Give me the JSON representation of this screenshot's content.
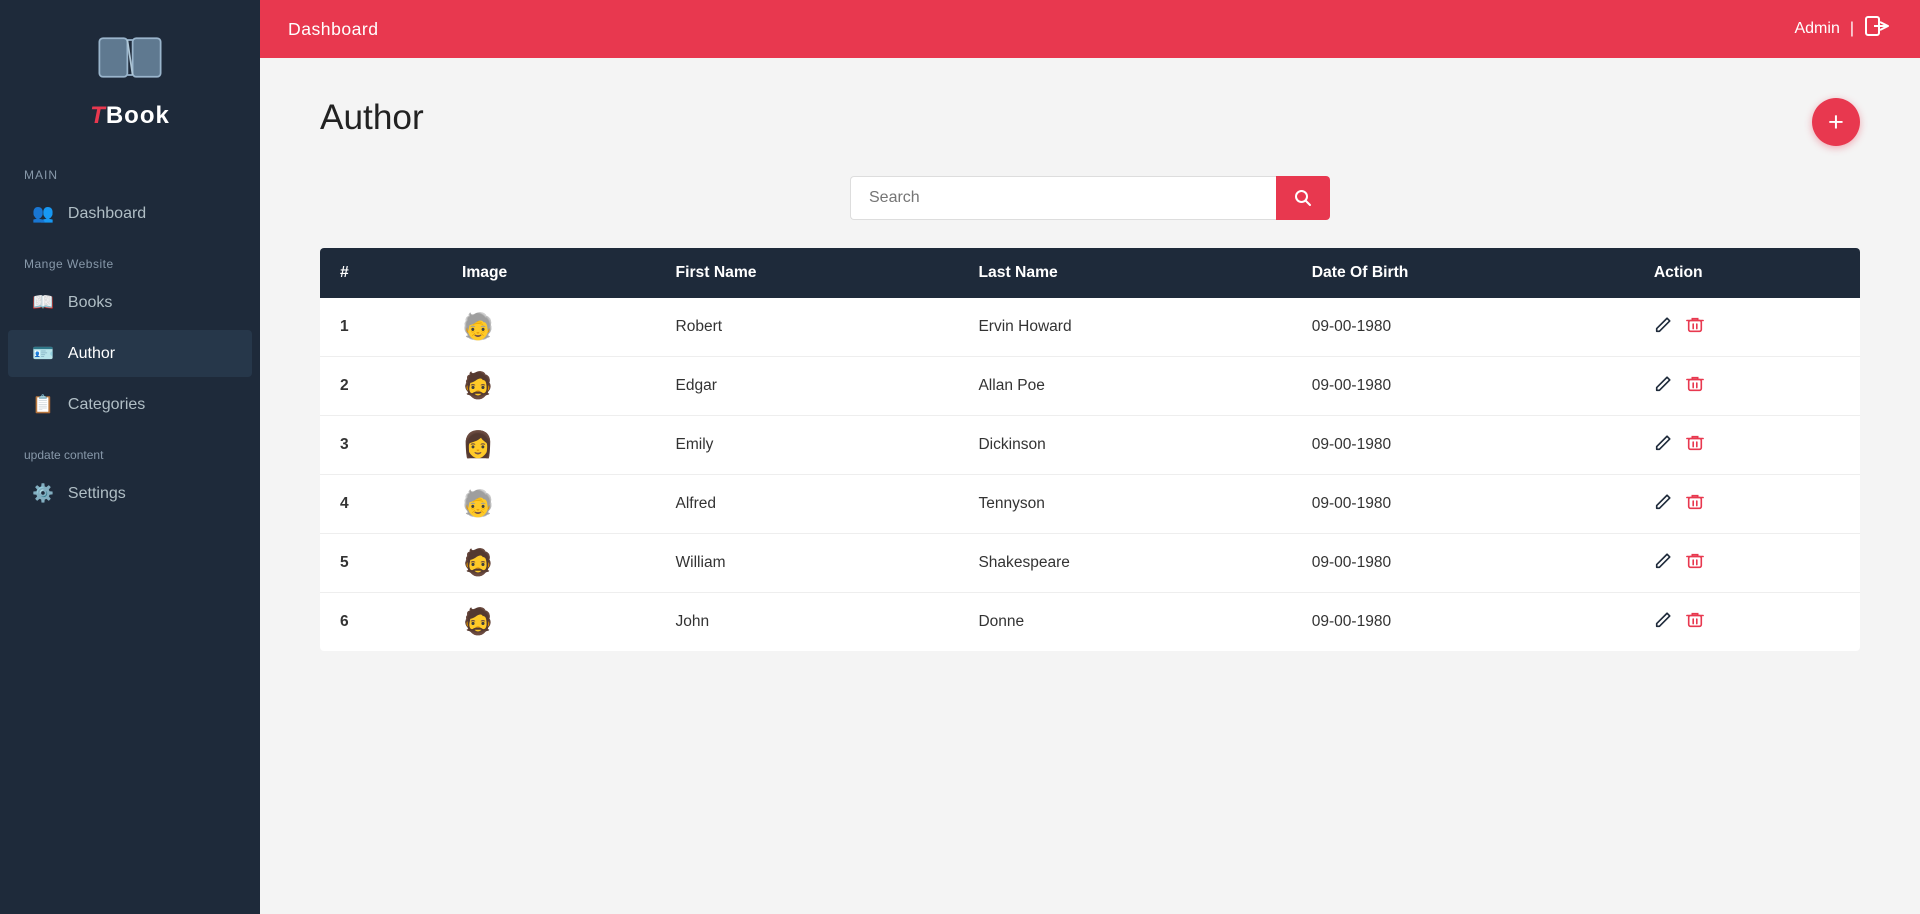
{
  "app": {
    "title_t": "T",
    "title_book": "Book"
  },
  "topbar": {
    "title": "Dashboard",
    "user": "Admin",
    "separator": "|"
  },
  "sidebar": {
    "section_main": "Main",
    "section_manage": "Mange Website",
    "section_update": "update content",
    "items": [
      {
        "id": "dashboard",
        "label": "Dashboard",
        "icon": "👥",
        "active": false
      },
      {
        "id": "books",
        "label": "Books",
        "icon": "📖",
        "active": false
      },
      {
        "id": "author",
        "label": "Author",
        "icon": "🪪",
        "active": true
      },
      {
        "id": "categories",
        "label": "Categories",
        "icon": "📋",
        "active": false
      },
      {
        "id": "settings",
        "label": "Settings",
        "icon": "⚙️",
        "active": false
      }
    ]
  },
  "page": {
    "title": "Author",
    "add_button_label": "+",
    "search_placeholder": "Search"
  },
  "table": {
    "columns": [
      "#",
      "Image",
      "First Name",
      "Last Name",
      "Date Of Birth",
      "Action"
    ],
    "rows": [
      {
        "num": "1",
        "avatar": "🧑",
        "first_name": "Robert",
        "last_name": "Ervin Howard",
        "dob": "09-00-1980"
      },
      {
        "num": "2",
        "avatar": "🧑",
        "first_name": "Edgar",
        "last_name": "Allan Poe",
        "dob": "09-00-1980"
      },
      {
        "num": "3",
        "avatar": "🧑",
        "first_name": "Emily",
        "last_name": "Dickinson",
        "dob": "09-00-1980"
      },
      {
        "num": "4",
        "avatar": "🧑",
        "first_name": "Alfred",
        "last_name": "Tennyson",
        "dob": "09-00-1980"
      },
      {
        "num": "5",
        "avatar": "🧑",
        "first_name": "William",
        "last_name": "Shakespeare",
        "dob": "09-00-1980"
      },
      {
        "num": "6",
        "avatar": "🧑",
        "first_name": "John",
        "last_name": "Donne",
        "dob": "09-00-1980"
      }
    ]
  },
  "icons": {
    "logout": "↪",
    "edit": "✏",
    "delete": "🗑",
    "search": "🔍",
    "book_open": "📖"
  }
}
